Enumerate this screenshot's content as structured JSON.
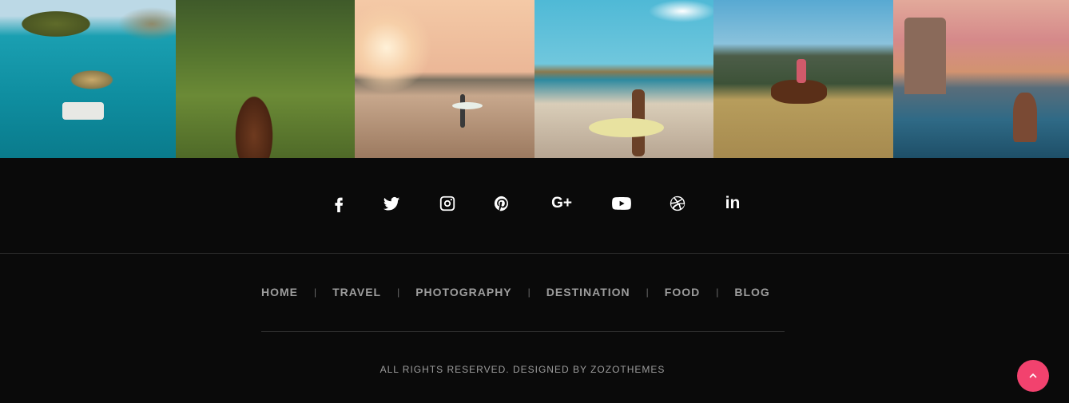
{
  "gallery": {
    "images": [
      {
        "icon": "island-photo"
      },
      {
        "icon": "horse-riding-photo"
      },
      {
        "icon": "surf-sunset-photo"
      },
      {
        "icon": "surfer-beach-photo"
      },
      {
        "icon": "horse-valley-photo"
      },
      {
        "icon": "infinity-pool-photo"
      }
    ]
  },
  "social": {
    "icons": [
      "facebook-icon",
      "twitter-icon",
      "instagram-icon",
      "pinterest-icon",
      "google-plus-icon",
      "youtube-icon",
      "dribbble-icon",
      "linkedin-icon"
    ],
    "google_plus_label": "G+",
    "linkedin_label": "in"
  },
  "menu": {
    "items": [
      "HOME",
      "TRAVEL",
      "PHOTOGRAPHY",
      "DESTINATION",
      "FOOD",
      "BLOG"
    ],
    "separator": "|"
  },
  "footer": {
    "copyright": "ALL RIGHTS RESERVED. DESIGNED BY ZOZOTHEMES"
  },
  "back_to_top": {
    "icon": "chevron-up-icon",
    "color": "#f2426e"
  },
  "colors": {
    "background": "#0a0a0a",
    "menu_text": "#9d9d9d",
    "icon": "#ffffff"
  }
}
